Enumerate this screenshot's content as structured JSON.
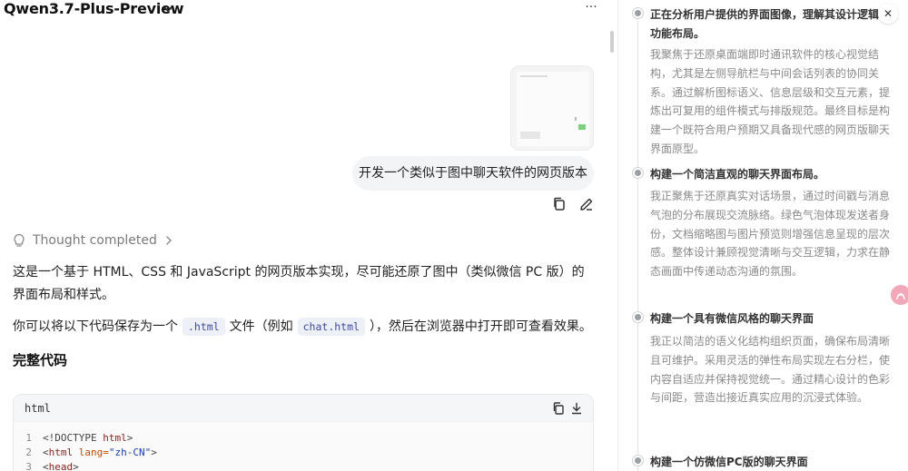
{
  "header": {
    "model_name": "Qwen3.7-Plus-Preview",
    "more_glyph": "···"
  },
  "chat": {
    "user_message": "开发一个类似于图中聊天软件的网页版本",
    "thought_label": "Thought completed",
    "reply_p1": "这是一个基于 HTML、CSS 和 JavaScript 的网页版本实现，尽可能还原了图中（类似微信 PC 版）的界面布局和样式。",
    "reply_p2_before": "你可以将以下代码保存为一个",
    "reply_p2_code1": ".html",
    "reply_p2_mid": "文件（例如",
    "reply_p2_code2": "chat.html",
    "reply_p2_after": "），然后在浏览器中打开即可查看效果。",
    "heading": "完整代码",
    "code_lang": "html",
    "code_lines": [
      {
        "n": "1",
        "tag": "<!DOCTYPE ",
        "name": "html",
        "close": ">"
      },
      {
        "n": "2",
        "open": "<",
        "name": "html",
        "attr": " lang=",
        "val": "\"zh-CN\"",
        "close": ">"
      },
      {
        "n": "3",
        "open": "<",
        "name": "head",
        "close": ">"
      }
    ]
  },
  "panel": {
    "close_glyph": "✕",
    "steps": [
      {
        "title": "正在分析用户提供的界面图像，理解其设计逻辑与功能布局。",
        "body": "我聚焦于还原桌面端即时通讯软件的核心视觉结构，尤其是左侧导航栏与中间会话列表的协同关系。通过解析图标语义、信息层级和交互元素，提炼出可复用的组件模式与排版规范。最终目标是构建一个既符合用户预期又具备现代感的网页版聊天界面原型。"
      },
      {
        "title": "构建一个简洁直观的聊天界面布局。",
        "body": "我正聚焦于还原真实对话场景，通过时间戳与消息气泡的分布展现交流脉络。绿色气泡体现发送者身份，文档缩略图与图片预览则增强信息呈现的层次感。整体设计兼顾视觉清晰与交互逻辑，力求在静态画面中传递动态沟通的氛围。"
      },
      {
        "title": "构建一个具有微信风格的聊天界面",
        "body": "我正以简洁的语义化结构组织页面，确保布局清晰且可维护。采用灵活的弹性布局实现左右分栏，使内容自适应并保持视觉统一。通过精心设计的色彩与间距，营造出接近真实应用的沉浸式体验。"
      },
      {
        "title": "构建一个仿微信PC版的聊天界面",
        "body": ""
      }
    ]
  }
}
